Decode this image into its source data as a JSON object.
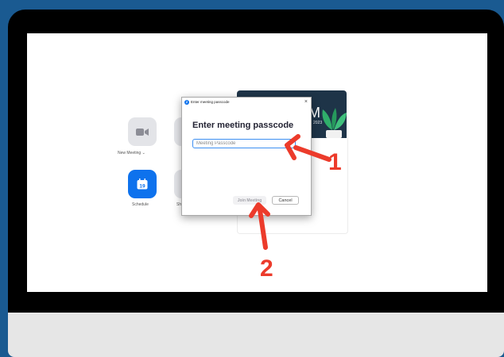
{
  "home": {
    "new_meeting_label": "New Meeting",
    "new_meeting_chevron": "⌄",
    "schedule_label": "Schedule",
    "schedule_day": "19",
    "share_label_partial": "Sh",
    "banner_letter": "M",
    "banner_year": "2023"
  },
  "dialog": {
    "window_title": "Enter meeting passcode",
    "logo_letter": "Z",
    "close_symbol": "×",
    "heading": "Enter meeting passcode",
    "passcode_placeholder": "Meeting Passcode",
    "passcode_value": "",
    "join_label": "Join Meeting",
    "cancel_label": "Cancel"
  },
  "annotations": {
    "step1": "1",
    "step2": "2"
  },
  "colors": {
    "background": "#1a5a91",
    "zoom_blue": "#0e72ed",
    "annotation_red": "#ec3b2b"
  },
  "icons": [
    "video-camera-icon",
    "calendar-icon",
    "zoom-logo-icon",
    "close-icon",
    "plant-icon"
  ]
}
